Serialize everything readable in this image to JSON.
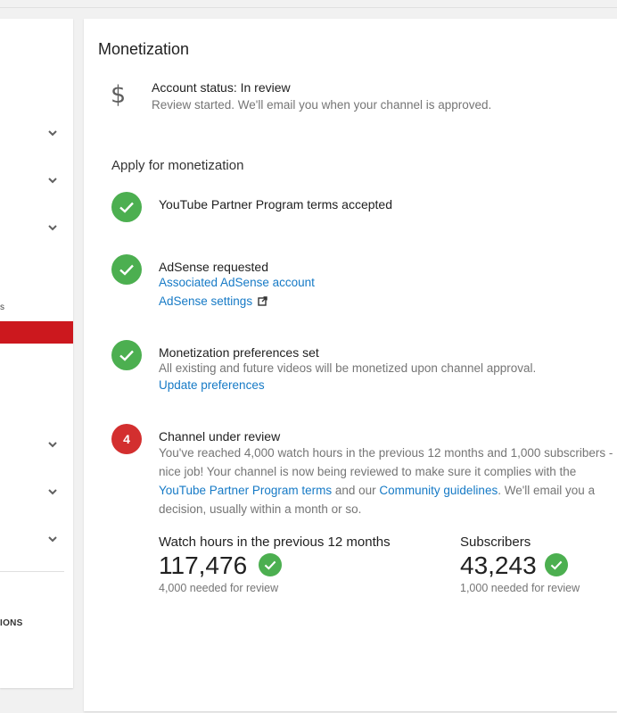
{
  "sidebar": {
    "snippet_top": "s",
    "snippet_bottom": "IONS"
  },
  "monetization": {
    "title": "Monetization",
    "account": {
      "status": "Account status: In review",
      "subtitle": "Review started. We'll email you when your channel is approved."
    },
    "apply_title": "Apply for monetization",
    "steps": [
      {
        "title": "YouTube Partner Program terms accepted"
      },
      {
        "title": "AdSense requested",
        "link1": "Associated AdSense account",
        "link2": "AdSense settings"
      },
      {
        "title": "Monetization preferences set",
        "text": "All existing and future videos will be monetized upon channel approval.",
        "link": "Update preferences"
      },
      {
        "number": "4",
        "title": "Channel under review",
        "text_a": "You've reached 4,000 watch hours in the previous 12 months and 1,000 subscribers - nice job! Your channel is now being reviewed to make sure it complies with the ",
        "link_terms": "YouTube Partner Program terms",
        "text_b": " and our ",
        "link_guidelines": "Community guidelines",
        "text_c": ". We'll email you a decision, usually within a month or so."
      }
    ],
    "metrics": {
      "watch_hours": {
        "label": "Watch hours in the previous 12 months",
        "value": "117,476",
        "needed": "4,000 needed for review"
      },
      "subscribers": {
        "label": "Subscribers",
        "value": "43,243",
        "needed": "1,000 needed for review"
      }
    }
  },
  "colors": {
    "check_green": "#4caf50",
    "step_red": "#d32f2f",
    "link_blue": "#167ac6",
    "sidebar_active_red": "#cc181e"
  }
}
